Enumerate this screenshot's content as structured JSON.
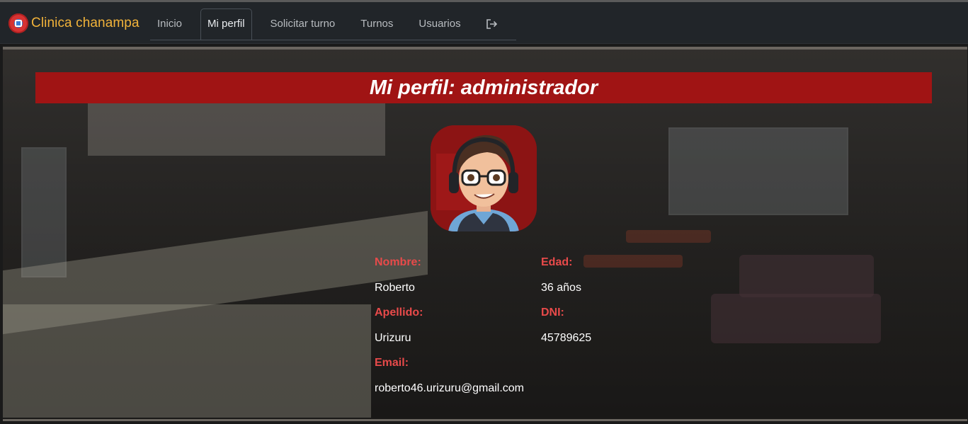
{
  "brand": {
    "name": "Clinica chanampa",
    "logo_icon": "clinic-logo-icon"
  },
  "nav": {
    "items": [
      {
        "label": "Inicio",
        "active": false
      },
      {
        "label": "Mi perfil",
        "active": true
      },
      {
        "label": "Solicitar turno",
        "active": false
      },
      {
        "label": "Turnos",
        "active": false
      },
      {
        "label": "Usuarios",
        "active": false
      }
    ],
    "logout_icon": "logout-icon"
  },
  "profile": {
    "title": "Mi perfil: administrador",
    "avatar_icon": "avatar-image",
    "fields": {
      "nombre_label": "Nombre:",
      "nombre_value": "Roberto",
      "edad_label": "Edad:",
      "edad_value": "36 años",
      "apellido_label": "Apellido:",
      "apellido_value": "Urizuru",
      "dni_label": "DNI:",
      "dni_value": "45789625",
      "email_label": "Email:",
      "email_value": "roberto46.urizuru@gmail.com"
    }
  },
  "colors": {
    "navbar_bg": "#212529",
    "brand": "#f2b33a",
    "header_bar": "#a01414",
    "label_red": "#e84a4a"
  }
}
